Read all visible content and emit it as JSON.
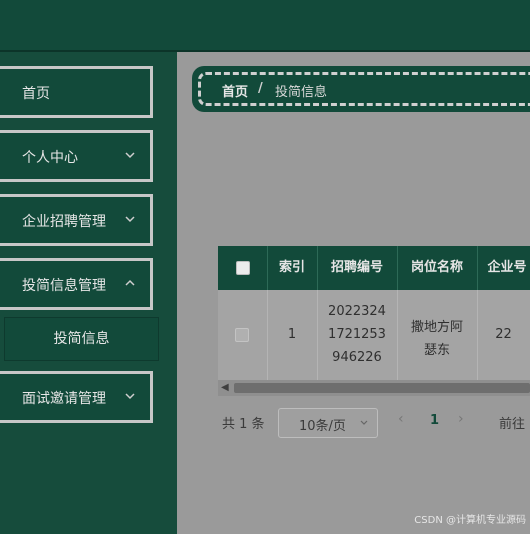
{
  "sidebar": {
    "items": [
      {
        "label": "首页",
        "has_arrow": false
      },
      {
        "label": "个人中心",
        "has_arrow": true
      },
      {
        "label": "企业招聘管理",
        "has_arrow": true
      },
      {
        "label": "投简信息管理",
        "has_arrow": true
      },
      {
        "label": "面试邀请管理",
        "has_arrow": true
      }
    ],
    "submenu_item": "投简信息"
  },
  "breadcrumb": {
    "home": "首页",
    "separator": "/",
    "current": "投简信息"
  },
  "table": {
    "headers": [
      "索引",
      "招聘编号",
      "岗位名称",
      "企业号"
    ],
    "rows": [
      {
        "index": "1",
        "recruit_no_lines": [
          "2022324",
          "1721253",
          "946226"
        ],
        "job_lines": [
          "撒地方阿",
          "瑟东"
        ],
        "company": "22"
      }
    ]
  },
  "pagination": {
    "total": "共 1 条",
    "page_size": "10条/页",
    "current_page": "1",
    "goto": "前往"
  },
  "watermark": "CSDN @计算机专业源码",
  "colors": {
    "sidebar": "#164c3c",
    "accent": "#124a3a",
    "overlay_bg": "#9a9a9a"
  }
}
